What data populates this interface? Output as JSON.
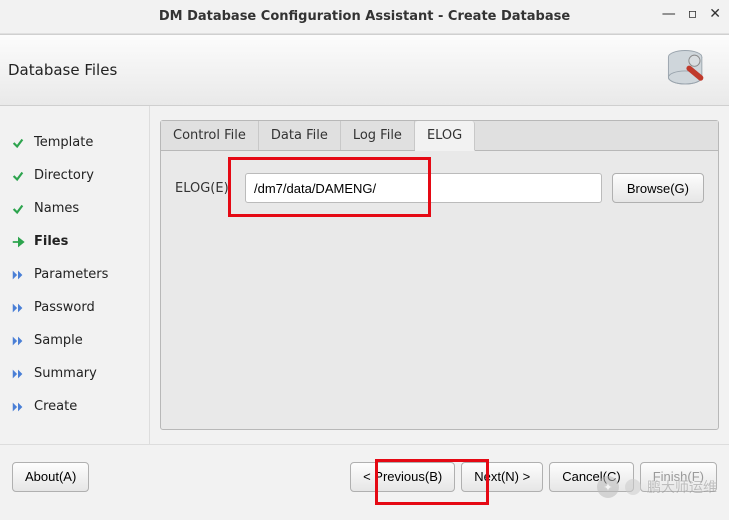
{
  "window": {
    "title": "DM Database Configuration Assistant - Create Database"
  },
  "header": {
    "title": "Database Files"
  },
  "sidebar": {
    "items": [
      {
        "label": "Template",
        "state": "done"
      },
      {
        "label": "Directory",
        "state": "done"
      },
      {
        "label": "Names",
        "state": "done"
      },
      {
        "label": "Files",
        "state": "active"
      },
      {
        "label": "Parameters",
        "state": "pending"
      },
      {
        "label": "Password",
        "state": "pending"
      },
      {
        "label": "Sample",
        "state": "pending"
      },
      {
        "label": "Summary",
        "state": "pending"
      },
      {
        "label": "Create",
        "state": "pending"
      }
    ]
  },
  "tabs": {
    "items": [
      {
        "label": "Control File"
      },
      {
        "label": "Data File"
      },
      {
        "label": "Log File"
      },
      {
        "label": "ELOG"
      }
    ],
    "activeIndex": 3
  },
  "form": {
    "elog_label": "ELOG(E)",
    "elog_value": "/dm7/data/DAMENG/",
    "browse_label": "Browse(G)"
  },
  "footer": {
    "about": "About(A)",
    "previous": "< Previous(B)",
    "next": "Next(N) >",
    "cancel": "Cancel(C)",
    "finish": "Finish(F)"
  },
  "watermark": {
    "text": "鹏大师运维"
  }
}
